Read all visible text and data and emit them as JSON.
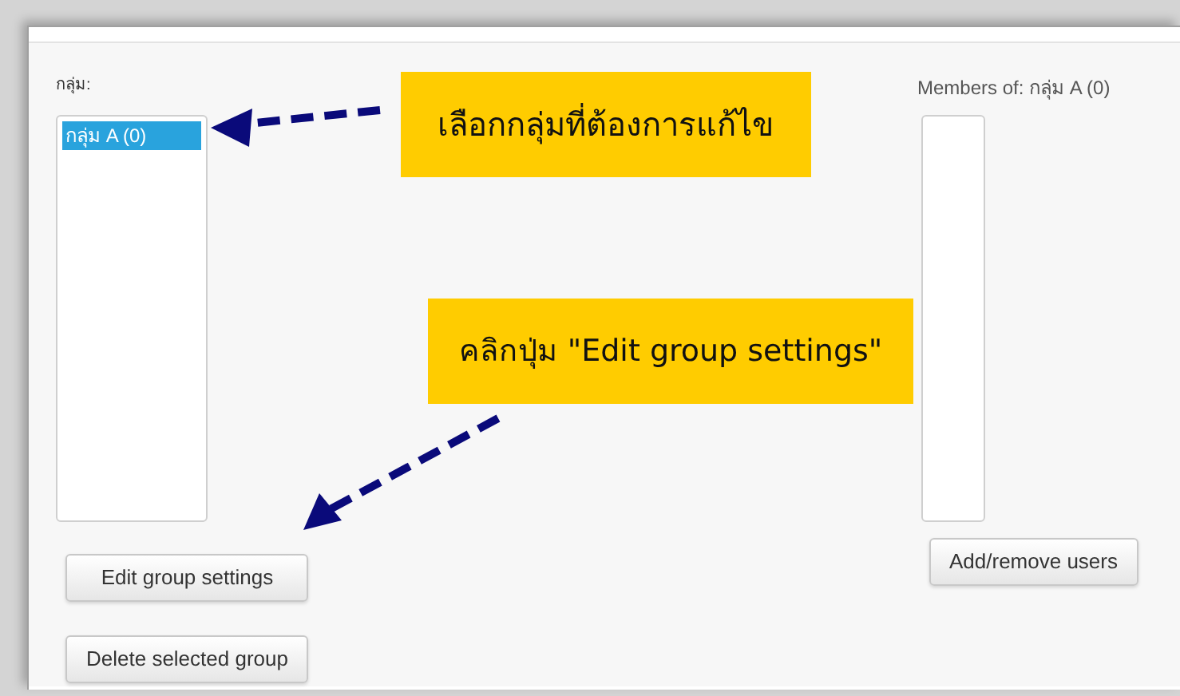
{
  "groups_label": "กลุ่ม:",
  "groups": [
    {
      "label": "กลุ่ม A (0)",
      "selected": true
    }
  ],
  "members_label": "Members of: กลุ่ม A (0)",
  "left_buttons": [
    "Edit group settings",
    "Delete selected group"
  ],
  "right_buttons": [
    "Add/remove users"
  ],
  "callouts": [
    {
      "text": "เลือกกลุ่มที่ต้องการแก้ไข"
    },
    {
      "text": "คลิกปุ่ม \"Edit group settings\""
    }
  ]
}
